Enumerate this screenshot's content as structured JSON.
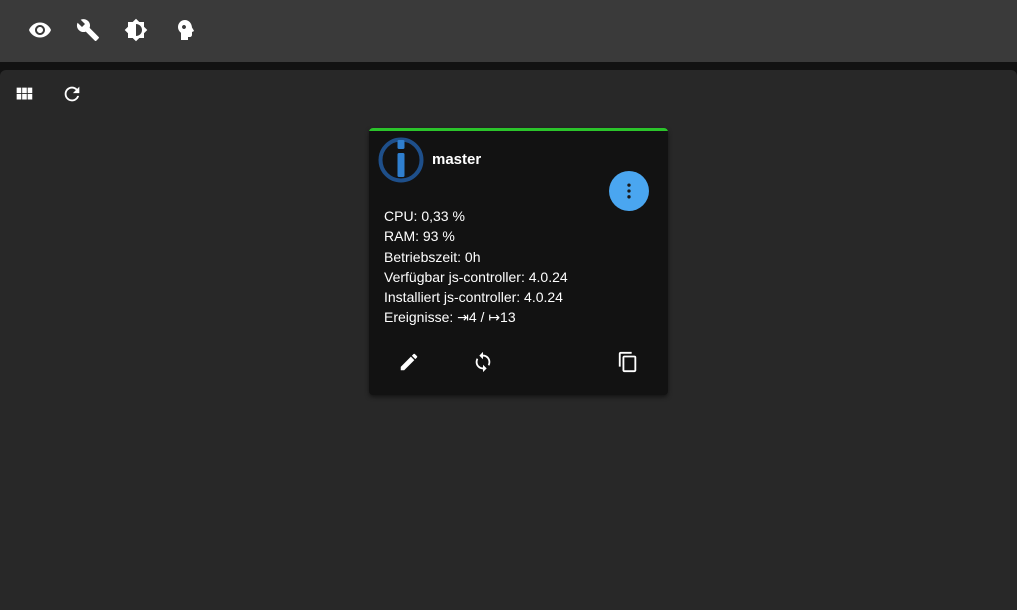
{
  "topbar": {
    "icons": [
      {
        "name": "eye-icon"
      },
      {
        "name": "wrench-icon"
      },
      {
        "name": "brightness-icon"
      },
      {
        "name": "expert-mode-head-icon"
      }
    ]
  },
  "toolbar": {
    "icons": [
      {
        "name": "grid-view-icon"
      },
      {
        "name": "refresh-icon"
      }
    ]
  },
  "card": {
    "title": "master",
    "status_color": "#2bc42b",
    "menu_button_color": "#4aa6f0",
    "info": {
      "cpu": "CPU: 0,33 %",
      "ram": "RAM: 93 %",
      "uptime": "Betriebszeit: 0h",
      "available_controller": "Verfügbar js-controller: 4.0.24",
      "installed_controller": "Installiert js-controller: 4.0.24",
      "events": "Ereignisse: ⇥4 / ↦13"
    },
    "actions": [
      {
        "name": "edit-icon"
      },
      {
        "name": "sync-icon"
      },
      {
        "name": "copy-icon"
      }
    ]
  }
}
